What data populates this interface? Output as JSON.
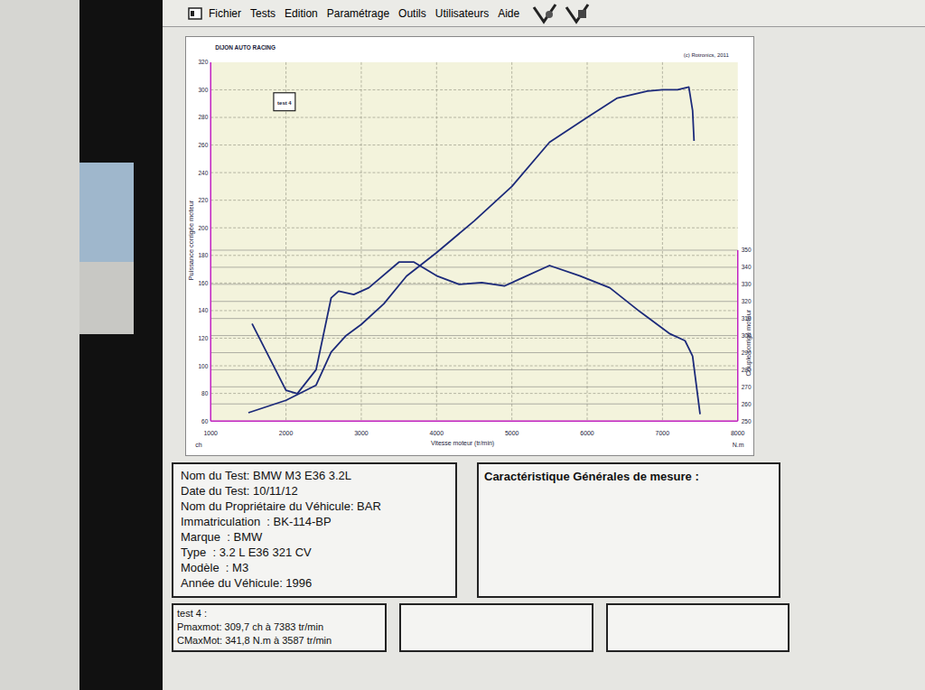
{
  "menu": [
    "Fichier",
    "Tests",
    "Edition",
    "Paramétrage",
    "Outils",
    "Utilisateurs",
    "Aide"
  ],
  "chart": {
    "header_left": "DIJON AUTO RACING",
    "header_right": "(c) Rotronics, 2011",
    "legend_label": "test 4",
    "x_axis": {
      "title": "Vitesse moteur (tr/min)",
      "unit_left": "ch",
      "unit_right": "N.m",
      "ticks": [
        "1000",
        "2000",
        "3000",
        "4000",
        "5000",
        "6000",
        "7000",
        "8000"
      ]
    },
    "y_left": {
      "title": "Puissance corrigée moteur",
      "ticks": [
        "60",
        "80",
        "100",
        "120",
        "140",
        "160",
        "180",
        "200",
        "220",
        "240",
        "260",
        "280",
        "300",
        "320"
      ]
    },
    "y_right": {
      "title": "Couple corrigé moteur",
      "ticks": [
        "250",
        "260",
        "270",
        "280",
        "290",
        "300",
        "310",
        "320",
        "330",
        "340",
        "350"
      ]
    },
    "series": [
      {
        "name": "power",
        "axis": "left",
        "rpm": [
          1500,
          2000,
          2400,
          2600,
          2800,
          3000,
          3300,
          3600,
          4000,
          4500,
          5000,
          5500,
          6000,
          6400,
          6800,
          7000,
          7200,
          7350,
          7400,
          7420
        ],
        "values": [
          66,
          75,
          86,
          110,
          122,
          130,
          145,
          165,
          182,
          205,
          230,
          262,
          280,
          294,
          299,
          300,
          300,
          302,
          285,
          263
        ]
      },
      {
        "name": "torque",
        "axis": "right",
        "rpm": [
          1550,
          2000,
          2150,
          2400,
          2600,
          2700,
          2900,
          3100,
          3500,
          3700,
          4000,
          4300,
          4600,
          4900,
          5100,
          5500,
          5900,
          6300,
          6700,
          7100,
          7300,
          7400,
          7500
        ],
        "values": [
          307,
          268,
          266,
          280,
          322,
          326,
          324,
          328,
          343,
          343,
          335,
          330,
          331,
          329,
          333,
          341,
          335,
          328,
          314,
          301,
          297,
          288,
          254
        ]
      }
    ]
  },
  "test_info": [
    "Nom du Test: BMW M3 E36 3.2L",
    "Date du Test: 10/11/12",
    "Nom du Propriétaire du Véhicule: BAR",
    "Immatriculation  : BK-114-BP",
    "Marque  : BMW",
    "Type  : 3.2 L E36 321 CV",
    "Modèle  : M3",
    "Année du Véhicule: 1996"
  ],
  "measure_title": "Caractéristique Générales de mesure :",
  "results": {
    "title": "test 4 :",
    "lines": [
      "Pmaxmot: 309,7 ch à 7383 tr/min",
      "CMaxMot: 341,8 N.m à 3587 tr/min"
    ]
  }
}
